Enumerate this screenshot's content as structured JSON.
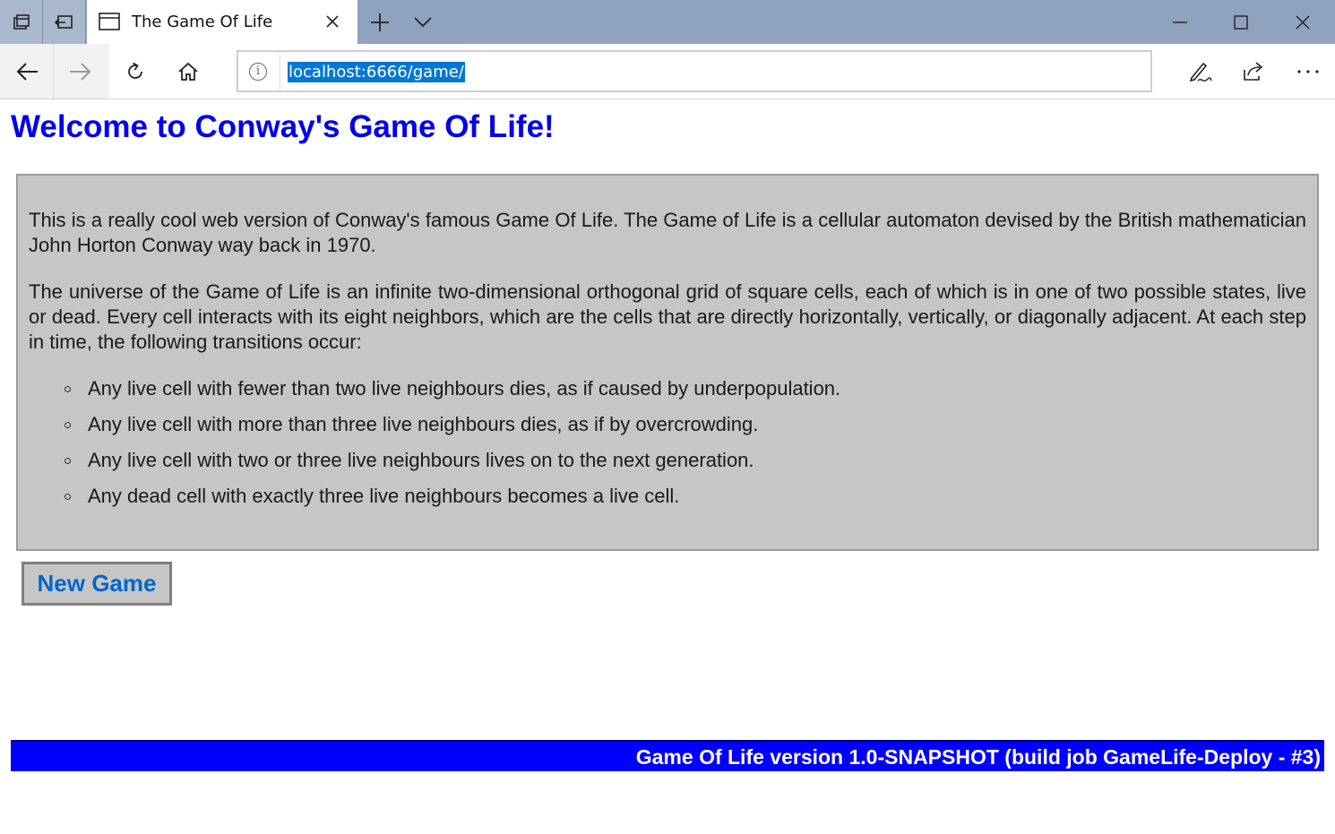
{
  "browser": {
    "tab_title": "The Game Of Life",
    "address_url": "localhost:6666/game/",
    "address_info_glyph": "i"
  },
  "page": {
    "heading": "Welcome to Conway's Game Of Life!",
    "paragraphs": [
      "This is a really cool web version of Conway's famous Game Of Life. The Game of Life is a cellular automaton devised by the British mathematician John Horton Conway way back in 1970.",
      "The universe of the Game of Life is an infinite two-dimensional orthogonal grid of square cells, each of which is in one of two possible states, live or dead. Every cell interacts with its eight neighbors, which are the cells that are directly horizontally, vertically, or diagonally adjacent. At each step in time, the following transitions occur:"
    ],
    "rules": [
      "Any live cell with fewer than two live neighbours dies, as if caused by underpopulation.",
      "Any live cell with more than three live neighbours dies, as if by overcrowding.",
      "Any live cell with two or three live neighbours lives on to the next generation.",
      "Any dead cell with exactly three live neighbours becomes a live cell."
    ],
    "new_game_label": "New Game",
    "footer_text": "Game Of Life version 1.0-SNAPSHOT (build job GameLife-Deploy - #3)"
  },
  "colors": {
    "tabstrip": "#8fa3bf",
    "heading": "#0000ee",
    "info_box": "#c6c6c6",
    "button_text": "#0066cc",
    "footer": "#0000ff",
    "url_selection": "#0078d7"
  }
}
